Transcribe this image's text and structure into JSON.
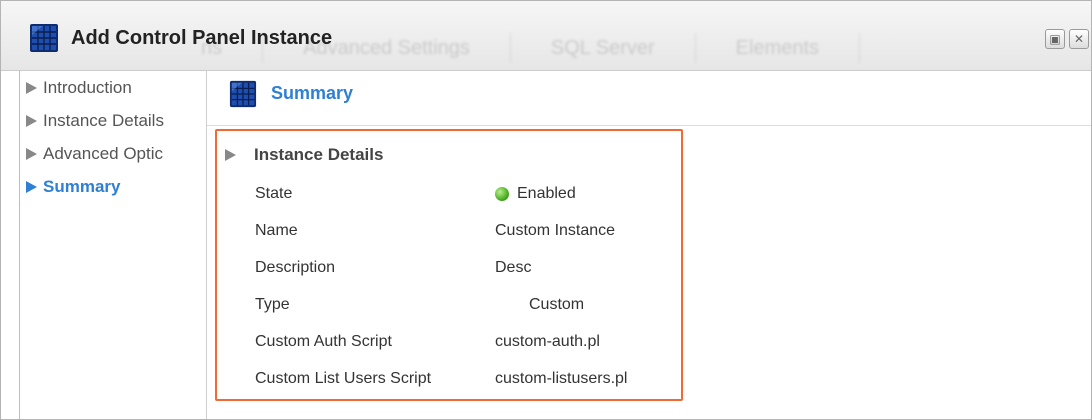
{
  "window": {
    "title": "Add Control Panel Instance",
    "background_toolbar": [
      "ns",
      "Advanced Settings",
      "SQL Server",
      "Elements"
    ]
  },
  "sidebar": {
    "items": [
      {
        "label": "Introduction",
        "active": false
      },
      {
        "label": "Instance Details",
        "active": false
      },
      {
        "label": "Advanced Optic",
        "active": false
      },
      {
        "label": "Summary",
        "active": true
      }
    ]
  },
  "content": {
    "header_title": "Summary",
    "section_title": "Instance Details",
    "rows": [
      {
        "label": "State",
        "value": "Enabled",
        "status": "green"
      },
      {
        "label": "Name",
        "value": "Custom Instance"
      },
      {
        "label": "Description",
        "value": "Desc"
      },
      {
        "label": "Type",
        "value": "Custom"
      },
      {
        "label": "Custom Auth Script",
        "value": "custom-auth.pl"
      },
      {
        "label": "Custom List Users Script",
        "value": "custom-listusers.pl"
      }
    ]
  },
  "colors": {
    "accent": "#2f7fd4",
    "highlight_border": "#f16a35",
    "status_enabled": "#45a81d"
  },
  "icons": {
    "app": "solar-panel-icon",
    "header": "solar-panel-icon",
    "nav_arrow": "triangle-right-icon",
    "status": "green-dot-icon"
  }
}
